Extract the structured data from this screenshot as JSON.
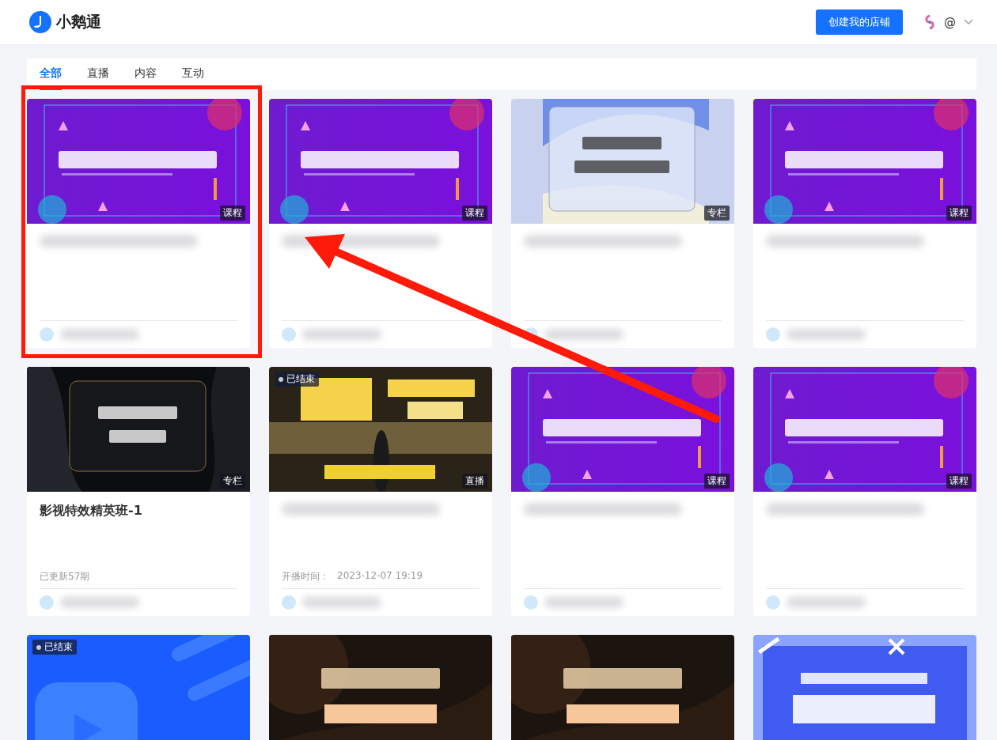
{
  "header": {
    "logo_text": "小鹅通",
    "create_button": "创建我的店铺",
    "account_label": "@"
  },
  "tabs": [
    {
      "label": "全部",
      "selected": true
    },
    {
      "label": "直播",
      "selected": false
    },
    {
      "label": "内容",
      "selected": false
    },
    {
      "label": "互动",
      "selected": false
    }
  ],
  "cards": [
    {
      "kind": "purple",
      "badge": "课程"
    },
    {
      "kind": "purple",
      "badge": "课程"
    },
    {
      "kind": "glass",
      "badge": "专栏"
    },
    {
      "kind": "purple",
      "badge": "课程"
    },
    {
      "kind": "dark",
      "badge": "专栏",
      "title": "影视特效精英班-1",
      "meta": "已更新57期"
    },
    {
      "kind": "ai",
      "badge": "直播",
      "status": "已结束",
      "meta_label": "开播时间：",
      "meta": "2023-12-07 19:19"
    },
    {
      "kind": "purple",
      "badge": "课程"
    },
    {
      "kind": "purple",
      "badge": "课程"
    },
    {
      "kind": "blue",
      "status": "已结束"
    },
    {
      "kind": "bronze"
    },
    {
      "kind": "bronze"
    },
    {
      "kind": "c4d"
    }
  ],
  "annotation": {
    "highlight_box": true,
    "arrow": true
  }
}
